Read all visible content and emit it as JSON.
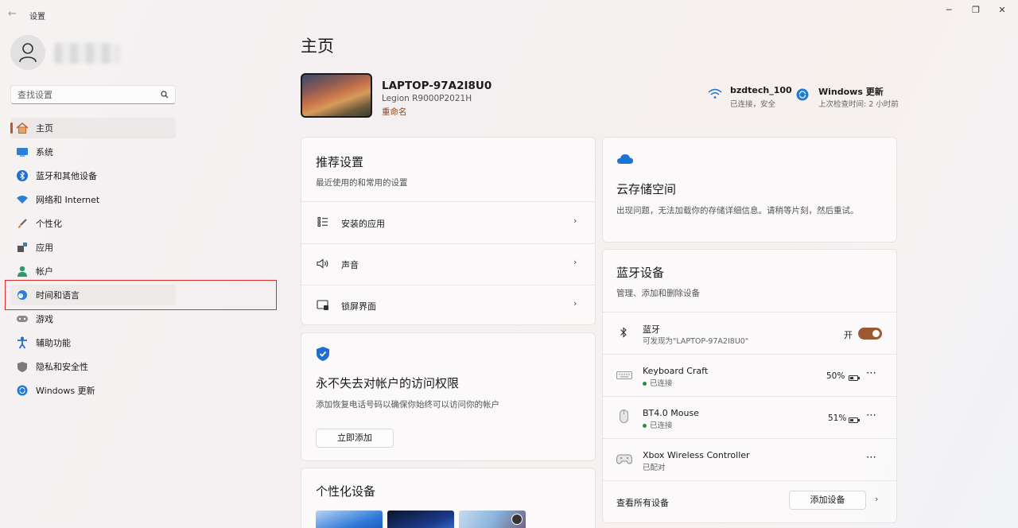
{
  "window": {
    "title": "设置",
    "back": "←",
    "minimize": "─",
    "restore": "❐",
    "close": "✕"
  },
  "search": {
    "placeholder": "查找设置"
  },
  "sidebar": {
    "items": [
      {
        "label": "主页",
        "icon": "home-icon",
        "selected": true
      },
      {
        "label": "系统",
        "icon": "system-icon"
      },
      {
        "label": "蓝牙和其他设备",
        "icon": "bluetooth-icon"
      },
      {
        "label": "网络和 Internet",
        "icon": "wifi-icon"
      },
      {
        "label": "个性化",
        "icon": "brush-icon"
      },
      {
        "label": "应用",
        "icon": "apps-icon"
      },
      {
        "label": "帐户",
        "icon": "account-icon"
      },
      {
        "label": "时间和语言",
        "icon": "time-language-icon"
      },
      {
        "label": "游戏",
        "icon": "gamepad-icon"
      },
      {
        "label": "辅助功能",
        "icon": "accessibility-icon"
      },
      {
        "label": "隐私和安全性",
        "icon": "shield-icon"
      },
      {
        "label": "Windows 更新",
        "icon": "update-icon"
      }
    ]
  },
  "page": {
    "title": "主页"
  },
  "device": {
    "name": "LAPTOP-97A2I8U0",
    "model": "Legion R9000P2021H",
    "rename": "重命名"
  },
  "status": {
    "wifi": {
      "name": "bzdtech_100",
      "detail": "已连接，安全"
    },
    "update": {
      "name": "Windows 更新",
      "detail": "上次检查时间: 2 小时前"
    }
  },
  "recommended": {
    "title": "推荐设置",
    "subtitle": "最近使用的和常用的设置",
    "items": [
      {
        "label": "安装的应用",
        "icon": "list-icon"
      },
      {
        "label": "声音",
        "icon": "speaker-icon"
      },
      {
        "label": "锁屏界面",
        "icon": "lock-screen-icon"
      }
    ]
  },
  "security": {
    "title": "永不失去对帐户的访问权限",
    "subtitle": "添加恢复电话号码以确保你始终可以访问你的帐户",
    "button": "立即添加"
  },
  "personalize": {
    "title": "个性化设备"
  },
  "cloud": {
    "title": "云存储空间",
    "subtitle": "出现问题，无法加载你的存储详细信息。请稍等片刻，然后重试。"
  },
  "bluetooth": {
    "title": "蓝牙设备",
    "subtitle": "管理、添加和删除设备",
    "toggle": {
      "label": "蓝牙",
      "detail": "可发现为\"LAPTOP-97A2I8U0\"",
      "state": "开"
    },
    "devices": [
      {
        "name": "Keyboard Craft",
        "status": "已连接",
        "battery": "50%",
        "more": "⋯"
      },
      {
        "name": "BT4.0 Mouse",
        "status": "已连接",
        "battery": "51%",
        "more": "⋯"
      },
      {
        "name": "Xbox Wireless Controller",
        "status": "已配对",
        "more": "⋯"
      }
    ],
    "view_all": "查看所有设备",
    "add_button": "添加设备"
  },
  "colors": {
    "accent": "#9a5a34",
    "selection": "#b55a2b",
    "highlight_box": "#e02a2a",
    "cloud": "#1b73d2"
  }
}
